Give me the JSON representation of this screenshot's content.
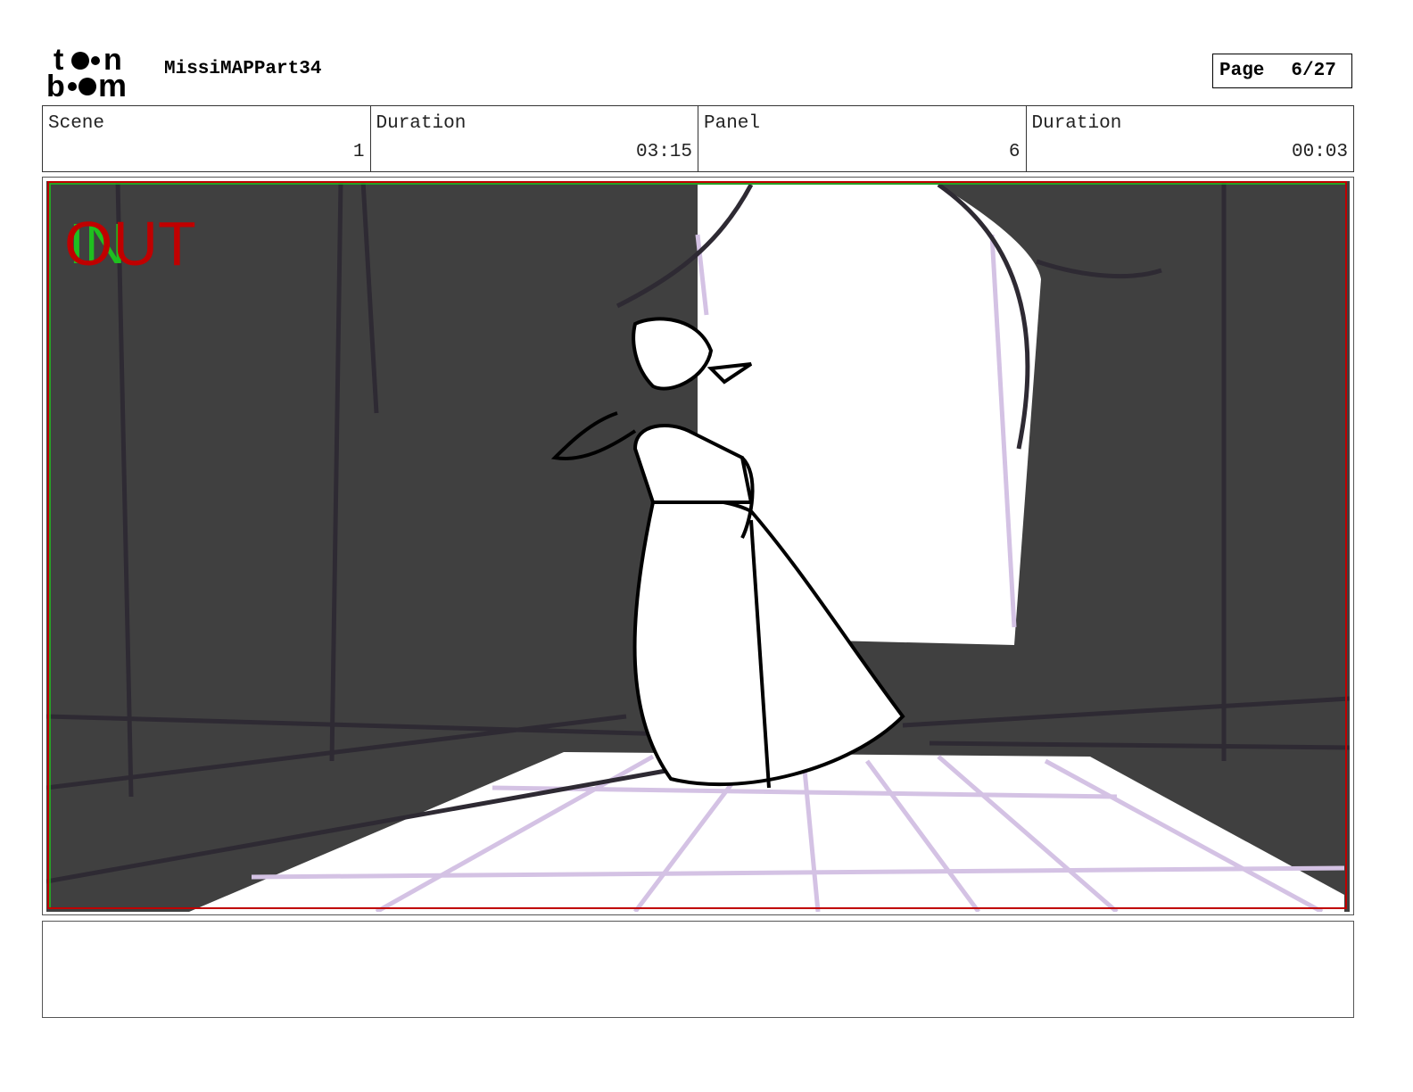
{
  "header": {
    "logo_text": "toon boom",
    "project_title": "MissiMAPPart34",
    "page_label": "Page",
    "page_value": "6/27"
  },
  "info": [
    {
      "label": "Scene",
      "value": "1"
    },
    {
      "label": "Duration",
      "value": "03:15"
    },
    {
      "label": "Panel",
      "value": "6"
    },
    {
      "label": "Duration",
      "value": "00:03"
    }
  ],
  "panel": {
    "in_marker": "IN",
    "out_marker": "OUT",
    "colors": {
      "background": "#404040",
      "light": "#ffffff",
      "grid": "#d4c2e4",
      "in": "#1fbf1f",
      "out": "#c00000"
    }
  },
  "notes": {
    "text": ""
  }
}
